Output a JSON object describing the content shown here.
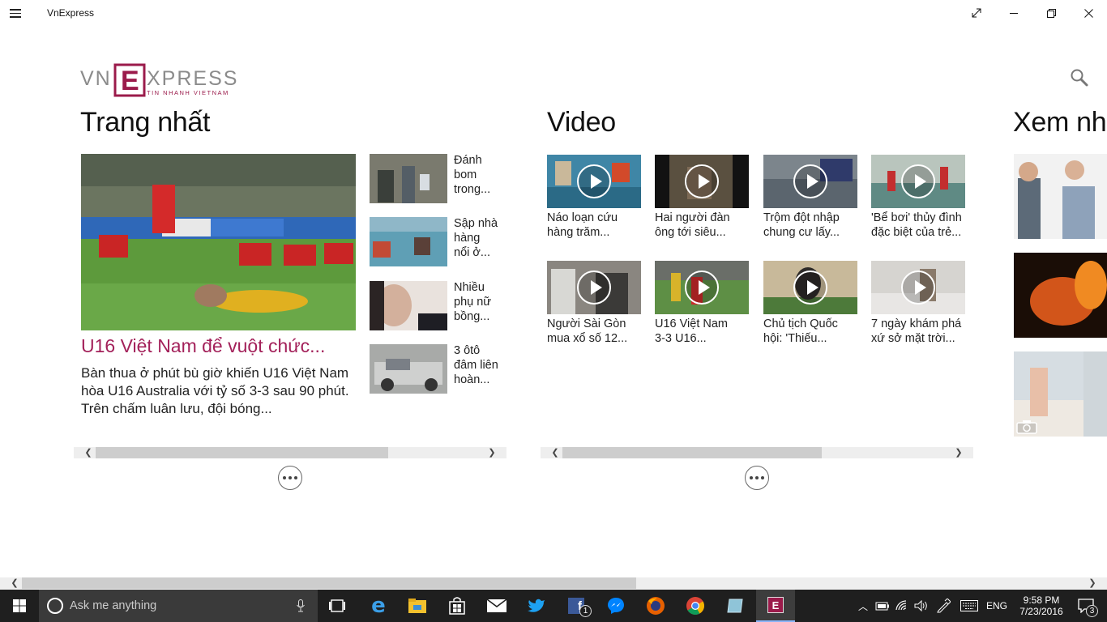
{
  "app": {
    "title": "VnExpress",
    "window_buttons": [
      "fullscreen-icon",
      "minimize-icon",
      "restore-icon",
      "close-icon"
    ]
  },
  "logo": {
    "part1": "VN",
    "mark": "E",
    "part2": "XPRESS",
    "tagline": "TIN NHANH VIETNAM"
  },
  "sections": {
    "trang_nhat": {
      "title": "Trang nhất",
      "featured": {
        "headline": "U16 Việt Nam để vuột chức...",
        "summary": "Bàn thua ở phút bù giờ khiến U16 Việt Nam hòa U16 Australia với tỷ số 3-3 sau 90 phút. Trên chấm luân lưu, đội bóng..."
      },
      "side_items": [
        {
          "lines": [
            "Đánh",
            "bom",
            "trong..."
          ]
        },
        {
          "lines": [
            "Sập nhà",
            "hàng",
            "nổi ở..."
          ]
        },
        {
          "lines": [
            "Nhiều",
            "phụ nữ",
            "bồng..."
          ]
        },
        {
          "lines": [
            "3 ôtô",
            "đâm liên",
            "hoàn..."
          ]
        }
      ]
    },
    "video": {
      "title": "Video",
      "items": [
        {
          "lines": [
            "Náo loạn cứu",
            "hàng trăm..."
          ]
        },
        {
          "lines": [
            "Hai người đàn",
            "ông tới siêu..."
          ]
        },
        {
          "lines": [
            "Trộm đột nhập",
            "chung cư lấy..."
          ]
        },
        {
          "lines": [
            "'Bể bơi' thủy đình",
            "đặc biệt của trẻ..."
          ]
        },
        {
          "lines": [
            "Người Sài Gòn",
            "mua xổ số 12..."
          ]
        },
        {
          "lines": [
            "U16 Việt Nam",
            "3-3 U16..."
          ]
        },
        {
          "lines": [
            "Chủ tịch Quốc",
            "hội: 'Thiếu..."
          ]
        },
        {
          "lines": [
            "7 ngày khám phá",
            "xứ sở mặt trời..."
          ]
        }
      ]
    },
    "xem_nhieu": {
      "title": "Xem nhi"
    }
  },
  "taskbar": {
    "search_placeholder": "Ask me anything",
    "language": "ENG",
    "time": "9:58 PM",
    "date": "7/23/2016",
    "notification_count": "3",
    "facebook_badge": "1",
    "apps": [
      "task-view-icon",
      "edge-icon",
      "file-explorer-icon",
      "store-icon",
      "mail-icon",
      "twitter-icon",
      "facebook-icon",
      "messenger-icon",
      "firefox-icon",
      "chrome-icon",
      "notepad-icon",
      "vnexpress-icon"
    ]
  },
  "colors": {
    "brand": "#9b1b4b",
    "headline": "#a3215a",
    "taskbar": "#1f1f1f"
  }
}
